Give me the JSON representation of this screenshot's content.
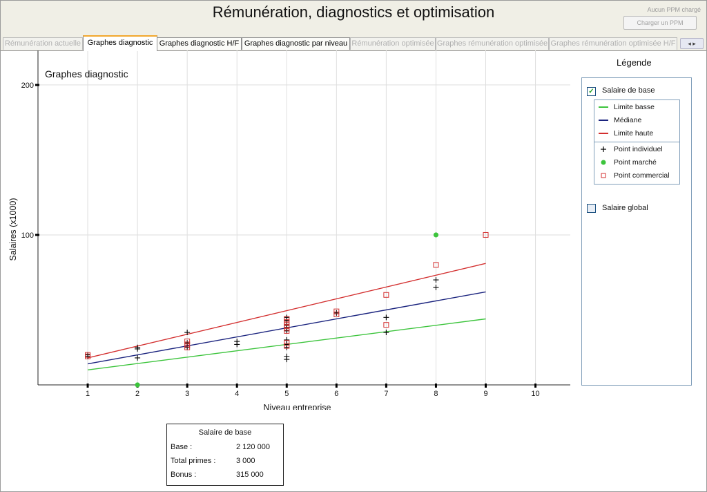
{
  "window": {
    "title": "Rémunération, diagnostics et optimisation",
    "aux_status": "Aucun PPM chargé",
    "aux_button": "Charger un PPM"
  },
  "tabs": [
    {
      "label": "Rémunération actuelle",
      "state": "disabled"
    },
    {
      "label": "Graphes diagnostic",
      "state": "active"
    },
    {
      "label": "Graphes diagnostic H/F",
      "state": "enabled"
    },
    {
      "label": "Graphes diagnostic par niveau",
      "state": "enabled"
    },
    {
      "label": "Rémunération optimisée",
      "state": "disabled"
    },
    {
      "label": "Graphes rémunération optimisée",
      "state": "disabled"
    },
    {
      "label": "Graphes rémunération optimisée H/F",
      "state": "disabled"
    }
  ],
  "tab_scroll": "◂ ▸",
  "chart_data": {
    "type": "scatter",
    "title": "Graphes diagnostic",
    "xlabel": "Niveau entreprise",
    "ylabel": "Salaires (x1000)",
    "xlim": [
      0.0,
      10.7
    ],
    "ylim": [
      0,
      223
    ],
    "x_ticks": [
      1,
      2,
      3,
      4,
      5,
      6,
      7,
      8,
      9,
      10
    ],
    "y_ticks": [
      100,
      200
    ],
    "grid": true,
    "lines": [
      {
        "name": "Limite basse",
        "color": "#3cc43c",
        "x": [
          1,
          9
        ],
        "y": [
          10,
          44
        ]
      },
      {
        "name": "Médiane",
        "color": "#1a237e",
        "x": [
          1,
          9
        ],
        "y": [
          14,
          62
        ]
      },
      {
        "name": "Limite haute",
        "color": "#d32f2f",
        "x": [
          1,
          9
        ],
        "y": [
          18,
          81
        ]
      }
    ],
    "series": [
      {
        "name": "Point individuel",
        "marker": "plus",
        "color": "#000000",
        "points": [
          [
            1,
            19
          ],
          [
            1,
            20
          ],
          [
            2,
            24
          ],
          [
            2,
            25
          ],
          [
            2,
            18
          ],
          [
            3,
            35
          ],
          [
            3,
            28
          ],
          [
            3,
            25
          ],
          [
            4,
            29
          ],
          [
            4,
            27
          ],
          [
            5,
            45
          ],
          [
            5,
            43
          ],
          [
            5,
            40
          ],
          [
            5,
            38
          ],
          [
            5,
            36
          ],
          [
            5,
            30
          ],
          [
            5,
            27
          ],
          [
            5,
            25
          ],
          [
            5,
            19
          ],
          [
            5,
            17
          ],
          [
            6,
            48
          ],
          [
            7,
            45
          ],
          [
            7,
            35
          ],
          [
            8,
            70
          ],
          [
            8,
            65
          ]
        ]
      },
      {
        "name": "Point marché",
        "marker": "dot",
        "color": "#3cc43c",
        "points": [
          [
            2,
            0
          ],
          [
            8,
            100
          ]
        ]
      },
      {
        "name": "Point commercial",
        "marker": "square",
        "color": "#d32f2f",
        "points": [
          [
            1,
            19
          ],
          [
            1,
            20
          ],
          [
            3,
            29
          ],
          [
            3,
            27
          ],
          [
            3,
            25
          ],
          [
            5,
            44
          ],
          [
            5,
            42
          ],
          [
            5,
            40
          ],
          [
            5,
            38
          ],
          [
            5,
            36
          ],
          [
            5,
            28
          ],
          [
            5,
            26
          ],
          [
            6,
            49
          ],
          [
            6,
            47
          ],
          [
            7,
            60
          ],
          [
            7,
            40
          ],
          [
            8,
            80
          ],
          [
            9,
            100
          ]
        ]
      }
    ]
  },
  "legend": {
    "title": "Légende",
    "salaire_de_base": {
      "label": "Salaire de base",
      "checked": true
    },
    "salaire_global": {
      "label": "Salaire global",
      "checked": false
    },
    "lines": [
      {
        "label": "Limite basse",
        "color": "#3cc43c"
      },
      {
        "label": "Médiane",
        "color": "#1a237e"
      },
      {
        "label": "Limite haute",
        "color": "#d32f2f"
      }
    ],
    "points": [
      {
        "label": "Point individuel",
        "marker": "plus",
        "color": "#000000"
      },
      {
        "label": "Point marché",
        "marker": "dot",
        "color": "#3cc43c"
      },
      {
        "label": "Point commercial",
        "marker": "square",
        "color": "#d32f2f"
      }
    ]
  },
  "summary": {
    "title": "Salaire de base",
    "rows": [
      {
        "label": "Base :",
        "value": "2 120 000"
      },
      {
        "label": "Total primes :",
        "value": "3 000"
      },
      {
        "label": "Bonus :",
        "value": "315 000"
      }
    ]
  }
}
